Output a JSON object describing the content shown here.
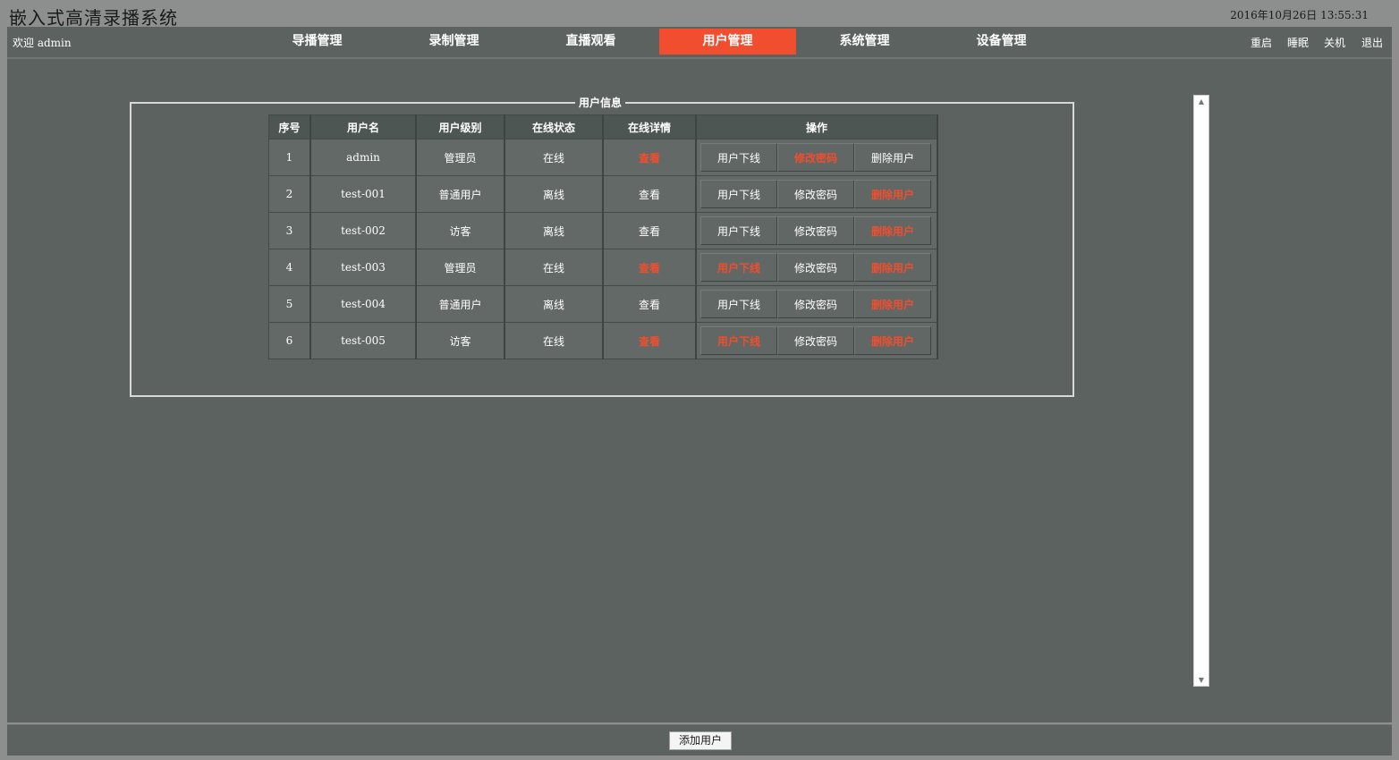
{
  "app": {
    "title": "嵌入式高清录播系统",
    "datetime": "2016年10月26日 13:55:31"
  },
  "navbar": {
    "welcome": "欢迎 admin",
    "tabs": [
      {
        "label": "导播管理"
      },
      {
        "label": "录制管理"
      },
      {
        "label": "直播观看"
      },
      {
        "label": "用户管理",
        "active": true
      },
      {
        "label": "系统管理"
      },
      {
        "label": "设备管理"
      }
    ],
    "system_buttons": [
      {
        "label": "重启"
      },
      {
        "label": "睡眠"
      },
      {
        "label": "关机"
      },
      {
        "label": "退出"
      }
    ]
  },
  "user_panel": {
    "legend": "用户信息",
    "columns": [
      "序号",
      "用户名",
      "用户级别",
      "在线状态",
      "在线详情",
      "操作"
    ],
    "rows": [
      {
        "id": "1",
        "username": "admin",
        "level": "管理员",
        "status": "在线",
        "detail": "查看",
        "ops": [
          "用户下线",
          "修改密码",
          "删除用户"
        ]
      },
      {
        "id": "2",
        "username": "test-001",
        "level": "普通用户",
        "status": "离线",
        "detail": "查看",
        "ops": [
          "用户下线",
          "修改密码",
          "删除用户"
        ]
      },
      {
        "id": "3",
        "username": "test-002",
        "level": "访客",
        "status": "离线",
        "detail": "查看",
        "ops": [
          "用户下线",
          "修改密码",
          "删除用户"
        ]
      },
      {
        "id": "4",
        "username": "test-003",
        "level": "管理员",
        "status": "在线",
        "detail": "查看",
        "ops": [
          "用户下线",
          "修改密码",
          "删除用户"
        ]
      },
      {
        "id": "5",
        "username": "test-004",
        "level": "普通用户",
        "status": "离线",
        "detail": "查看",
        "ops": [
          "用户下线",
          "修改密码",
          "删除用户"
        ]
      },
      {
        "id": "6",
        "username": "test-005",
        "level": "访客",
        "status": "在线",
        "detail": "查看",
        "ops": [
          "用户下线",
          "修改密码",
          "删除用户"
        ]
      }
    ]
  },
  "footer": {
    "add_user_label": "添加用户"
  },
  "colors": {
    "accent": "#f04e2e",
    "panel_bg": "#5c6260"
  }
}
